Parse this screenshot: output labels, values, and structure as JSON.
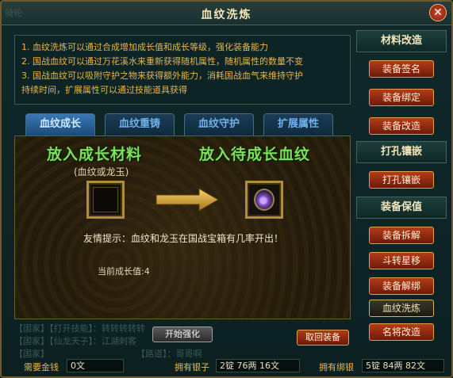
{
  "window": {
    "title": "血纹洗炼",
    "ghost_text": "骑轮"
  },
  "info_lines": [
    "1. 血纹洗炼可以通过合成增加成长值和成长等级，强化装备能力",
    "2. 国战血纹可以通过万花溪水来重新获得随机属性，随机属性的数量不变",
    "3. 国战血纹可以吸附守护之物来获得额外能力，消耗国战血气来维持守护",
    "持续时间，扩展属性可以通过技能道具获得"
  ],
  "tabs": [
    {
      "label": "血纹成长",
      "active": true
    },
    {
      "label": "血纹重铸",
      "active": false
    },
    {
      "label": "血纹守护",
      "active": false
    },
    {
      "label": "扩展属性",
      "active": false
    }
  ],
  "main": {
    "left_title": "放入成长材料",
    "left_subtitle": "(血纹或龙玉)",
    "right_title": "放入待成长血纹",
    "tip": "友情提示：血纹和龙玉在国战宝箱有几率开出！",
    "growth_label": "当前成长值:",
    "growth_value": "4"
  },
  "buttons": {
    "start": "开始强化",
    "retrieve": "取回装备"
  },
  "sidebar": {
    "sections": [
      {
        "title": "材料改造",
        "items": [
          "装备签名",
          "装备绑定",
          "装备改造"
        ]
      },
      {
        "title": "打孔镶嵌",
        "items": [
          "打孔镶嵌"
        ]
      },
      {
        "title": "装备保值",
        "items": [
          "装备拆解",
          "斗转星移",
          "装备解绑",
          "血纹洗炼",
          "名将改造"
        ]
      }
    ],
    "selected_item": "血纹洗炼"
  },
  "status": {
    "money_label": "需要金钱",
    "money_value": "0文",
    "silver_label": "拥有银子",
    "silver_value": "2锭 76两 16文",
    "bound_label": "拥有绑银",
    "bound_value": "5锭 84两 82文"
  },
  "chat_ghost": [
    "【国家】【打开技能】：转转转转转",
    "【国家】【仙龙天子】：江湖刺客",
    "【国家】",
    "【路道】：哥哥啊"
  ],
  "colors": {
    "accent_gold": "#e8b64a",
    "green_title": "#7be05a",
    "tab_blue": "#6fb1f0"
  }
}
